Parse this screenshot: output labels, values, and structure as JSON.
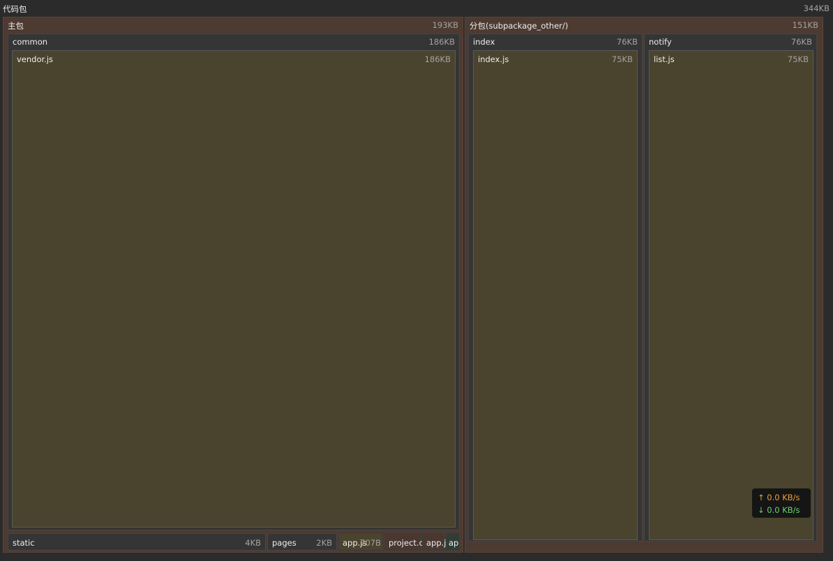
{
  "root": {
    "label": "代码包",
    "size": "344KB"
  },
  "main_package": {
    "label": "主包",
    "size": "193KB",
    "common": {
      "label": "common",
      "size": "186KB",
      "vendor": {
        "label": "vendor.js",
        "size": "186KB"
      }
    },
    "static": {
      "label": "static",
      "size": "4KB"
    },
    "pages": {
      "label": "pages",
      "size": "2KB"
    },
    "app_js": {
      "label": "app.js",
      "size": "707B"
    },
    "project_config": {
      "label": "project.c"
    },
    "app_json": {
      "label": "app.j"
    },
    "app_other": {
      "label": "ap"
    }
  },
  "sub_package": {
    "label": "分包(subpackage_other/)",
    "size": "151KB",
    "index": {
      "label": "index",
      "size": "76KB",
      "index_js": {
        "label": "index.js",
        "size": "75KB"
      }
    },
    "notify": {
      "label": "notify",
      "size": "76KB",
      "list_js": {
        "label": "list.js",
        "size": "75KB"
      }
    }
  },
  "net_speed": {
    "up": "↑ 0.0 KB/s",
    "down": "↓ 0.0 KB/s"
  },
  "colors": {
    "package_bg": "#4d3a31",
    "dir_bg": "#353535",
    "file_bg": "#4a432d",
    "upload": "#f0a030",
    "download": "#6fd36f"
  }
}
